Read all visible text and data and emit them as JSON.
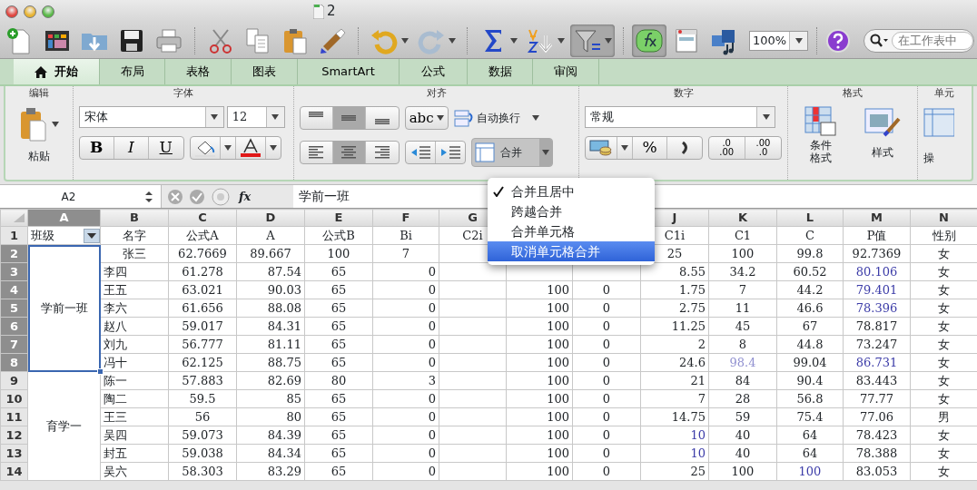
{
  "window": {
    "title": "2"
  },
  "toolbar": {
    "zoom": "100%",
    "search_placeholder": "在工作表中",
    "filter_on": true,
    "formula_builder_on": true
  },
  "tabs": [
    {
      "label": "开始",
      "selected": true
    },
    {
      "label": "布局",
      "selected": false
    },
    {
      "label": "表格",
      "selected": false
    },
    {
      "label": "图表",
      "selected": false
    },
    {
      "label": "SmartArt",
      "selected": false
    },
    {
      "label": "公式",
      "selected": false
    },
    {
      "label": "数据",
      "selected": false
    },
    {
      "label": "审阅",
      "selected": false
    }
  ],
  "ribbon": {
    "edit": {
      "title": "编辑",
      "paste_label": "粘贴"
    },
    "font": {
      "title": "字体",
      "font_name": "宋体",
      "font_size": "12",
      "bold_label": "B",
      "italic_label": "I",
      "underline_label": "U"
    },
    "align": {
      "title": "对齐",
      "vertical": [
        {
          "selected": false
        },
        {
          "selected": true
        },
        {
          "selected": false
        }
      ],
      "horizontal": [
        {
          "selected": false
        },
        {
          "selected": true
        },
        {
          "selected": false
        }
      ],
      "orientation_label": "abc",
      "wrap_label": "自动换行",
      "merge_label": "合并",
      "merge_open": true
    },
    "number": {
      "title": "数字",
      "format": "常规",
      "percent_label": "%",
      "decimals": [
        {
          "top": ".0",
          "bottom": ".00"
        },
        {
          "top": ".00",
          "bottom": ".0"
        }
      ]
    },
    "format": {
      "title": "格式",
      "conditional_label": "条件格式",
      "styles_label": "样式"
    },
    "cells": {
      "title": "单元",
      "label": "操"
    }
  },
  "formula_bar": {
    "cell_ref": "A2",
    "fx": "fx",
    "value": "学前一班"
  },
  "merge_menu": [
    {
      "label": "合并且居中",
      "checked": true,
      "selected": false
    },
    {
      "label": "跨越合并",
      "checked": false,
      "selected": false
    },
    {
      "label": "合并单元格",
      "checked": false,
      "selected": false
    },
    {
      "label": "取消单元格合并",
      "checked": false,
      "selected": true
    }
  ],
  "sheet": {
    "columns": [
      {
        "letter": "A"
      },
      {
        "letter": "B",
        "kind": "text"
      },
      {
        "letter": "C",
        "kind": "centered"
      },
      {
        "letter": "D",
        "kind": "numeric"
      },
      {
        "letter": "E",
        "kind": "centered"
      },
      {
        "letter": "F",
        "kind": "numeric"
      },
      {
        "letter": "G"
      },
      {
        "kind": "numeric"
      },
      {
        "kind": "centered"
      },
      {
        "letter": "J",
        "kind": "numeric"
      },
      {
        "letter": "K",
        "kind": "centered"
      },
      {
        "letter": "L",
        "kind": "centered"
      },
      {
        "letter": "M",
        "kind": "centered"
      },
      {
        "letter": "N",
        "kind": "centered"
      }
    ],
    "header_row": {
      "number": "1",
      "class_label": "班级",
      "filter": true,
      "cells": [
        {
          "text": "名字",
          "kind": "centered"
        },
        "公式A",
        {
          "text": "A",
          "kind": "centered"
        },
        "公式B",
        {
          "text": "Bi",
          "kind": "centered"
        },
        {
          "text": "C2i",
          "kind": "centered"
        },
        null,
        null,
        {
          "text": "C1i",
          "kind": "centered"
        },
        "C1",
        "C",
        "P值",
        "性别"
      ]
    },
    "groups": [
      {
        "class": "学前一班",
        "selected": true,
        "rows": [
          {
            "number": "2",
            "cells": [
              {
                "text": "张三",
                "kind": "centered"
              },
              "62.7669",
              {
                "text": "89.667",
                "kind": "centered"
              },
              "100",
              {
                "text": "7",
                "kind": "centered"
              },
              null,
              null,
              null,
              {
                "text": "25",
                "kind": "centered"
              },
              "100",
              "99.8",
              "92.7369",
              "女"
            ]
          },
          {
            "number": "3",
            "cells": [
              "李四",
              "61.278",
              "87.54",
              "65",
              "0",
              null,
              null,
              null,
              "8.55",
              "34.2",
              "60.52",
              {
                "text": "80.106",
                "color": "#3c3ca8"
              },
              "女"
            ]
          },
          {
            "number": "4",
            "cells": [
              "王五",
              "63.021",
              "90.03",
              "65",
              "0",
              null,
              "100",
              "0",
              "1.75",
              "7",
              "44.2",
              {
                "text": "79.401",
                "color": "#3c3ca8"
              },
              "女"
            ]
          },
          {
            "number": "5",
            "cells": [
              "李六",
              "61.656",
              "88.08",
              "65",
              "0",
              null,
              "100",
              "0",
              "2.75",
              "11",
              "46.6",
              {
                "text": "78.396",
                "color": "#3c3ca8"
              },
              "女"
            ]
          },
          {
            "number": "6",
            "cells": [
              "赵八",
              "59.017",
              "84.31",
              "65",
              "0",
              null,
              "100",
              "0",
              "11.25",
              "45",
              "67",
              "78.817",
              "女"
            ]
          },
          {
            "number": "7",
            "cells": [
              "刘九",
              "56.777",
              "81.11",
              "65",
              "0",
              null,
              "100",
              "0",
              "2",
              "8",
              "44.8",
              "73.247",
              "女"
            ]
          },
          {
            "number": "8",
            "cells": [
              "冯十",
              "62.125",
              "88.75",
              "65",
              "0",
              null,
              "100",
              "0",
              "24.6",
              {
                "text": "98.4",
                "color": "#9090d0"
              },
              "99.04",
              {
                "text": "86.731",
                "color": "#3c3ca8"
              },
              "女"
            ]
          }
        ]
      },
      {
        "class": "育学一",
        "selected": false,
        "rows": [
          {
            "number": "9",
            "cells": [
              "陈一",
              "57.883",
              "82.69",
              "80",
              "3",
              null,
              "100",
              "0",
              "21",
              "84",
              "90.4",
              "83.443",
              "女"
            ]
          },
          {
            "number": "10",
            "cells": [
              "陶二",
              "59.5",
              "85",
              "65",
              "0",
              null,
              "100",
              "0",
              "7",
              "28",
              "56.8",
              "77.77",
              "女"
            ]
          },
          {
            "number": "11",
            "cells": [
              "王三",
              "56",
              "80",
              "65",
              "0",
              null,
              "100",
              "0",
              "14.75",
              "59",
              "75.4",
              "77.06",
              "男"
            ]
          },
          {
            "number": "12",
            "cells": [
              "吴四",
              "59.073",
              "84.39",
              "65",
              "0",
              null,
              "100",
              "0",
              {
                "text": "10",
                "color": "#3c3ca8"
              },
              "40",
              "64",
              "78.423",
              "女"
            ]
          },
          {
            "number": "13",
            "cells": [
              "封五",
              "59.038",
              "84.34",
              "65",
              "0",
              null,
              "100",
              "0",
              {
                "text": "10",
                "color": "#3c3ca8"
              },
              "40",
              "64",
              "78.388",
              "女"
            ]
          },
          {
            "number": "14",
            "cells": [
              "吴六",
              "58.303",
              "83.29",
              "65",
              "0",
              null,
              "100",
              "0",
              "25",
              "100",
              {
                "text": "100",
                "color": "#3c3ca8"
              },
              "83.053",
              "女"
            ]
          }
        ]
      }
    ]
  }
}
